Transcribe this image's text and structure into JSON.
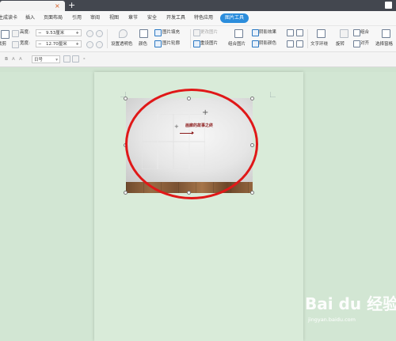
{
  "titlebar": {
    "tab_label": "",
    "close_glyph": "×",
    "new_tab_glyph": "+"
  },
  "menubar": {
    "items": [
      "生成读卡",
      "插入",
      "页面布局",
      "引用",
      "审阅",
      "视图",
      "章节",
      "安全",
      "开发工具",
      "特色应用",
      "图片工具"
    ],
    "active_index": 10
  },
  "ribbon": {
    "height_label": "高度:",
    "height_value": "9.53厘米",
    "width_label": "宽度:",
    "width_value": "12.70厘米",
    "crop_label": "裁剪",
    "set_transparent": "设置透明色",
    "color_label": "颜色",
    "fill_label": "图片填充",
    "outline_label": "图片轮廓",
    "change_pic": "更改图片",
    "reset_pic": "重设图片",
    "combine_pic": "组合图片",
    "shadow_effect": "阴影效果",
    "shadow_color": "阴影颜色",
    "text_wrap": "文字环绕",
    "rotate": "旋转",
    "group": "组合",
    "align": "对齐",
    "select_pane": "选择窗格"
  },
  "formatbar": {
    "font_size": "日号"
  },
  "document": {
    "wall_text": "画廊的故事之终"
  },
  "watermark": {
    "brand": "Bai du 经验",
    "url": "jingyan.baidu.com"
  },
  "colors": {
    "accent": "#2b8ddc",
    "highlight_ellipse": "#e01818",
    "page_bg": "#d9ebd9"
  }
}
